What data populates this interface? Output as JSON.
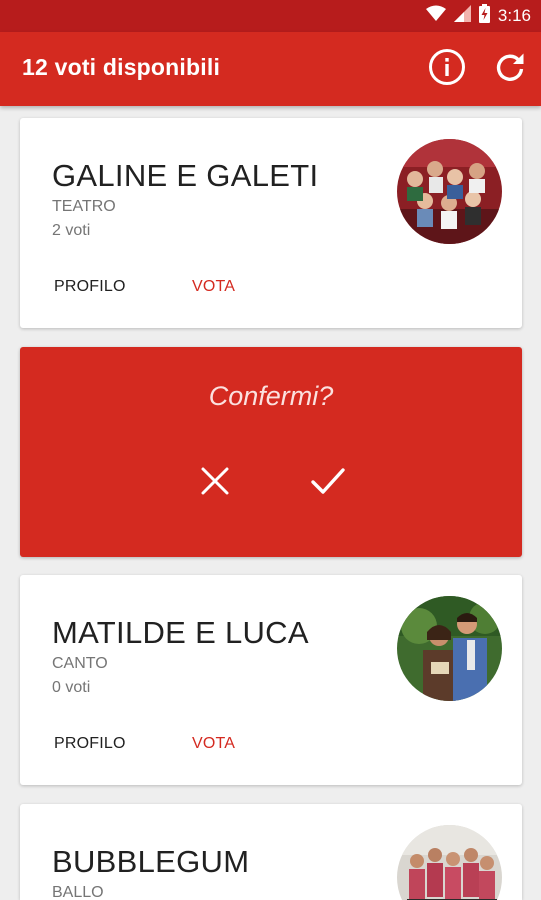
{
  "status_bar": {
    "time": "3:16"
  },
  "app_bar": {
    "title": "12 voti disponibili"
  },
  "cards": [
    {
      "name": "GALINE E GALETI",
      "category": "TEATRO",
      "votes": "2 voti",
      "profile_label": "PROFILO",
      "vote_label": "VOTA"
    },
    {
      "name": "MATILDE E LUCA",
      "category": "CANTO",
      "votes": "0 voti",
      "profile_label": "PROFILO",
      "vote_label": "VOTA"
    },
    {
      "name": "BUBBLEGUM",
      "category": "BALLO"
    }
  ],
  "confirm": {
    "question": "Confermi?"
  },
  "colors": {
    "primary": "#d42a20",
    "primary_dark": "#b71c1c",
    "background": "#eeeeee",
    "card": "#ffffff"
  },
  "icons": {
    "info": "info-icon",
    "refresh": "refresh-icon",
    "cancel": "close-icon",
    "confirm": "check-icon"
  }
}
